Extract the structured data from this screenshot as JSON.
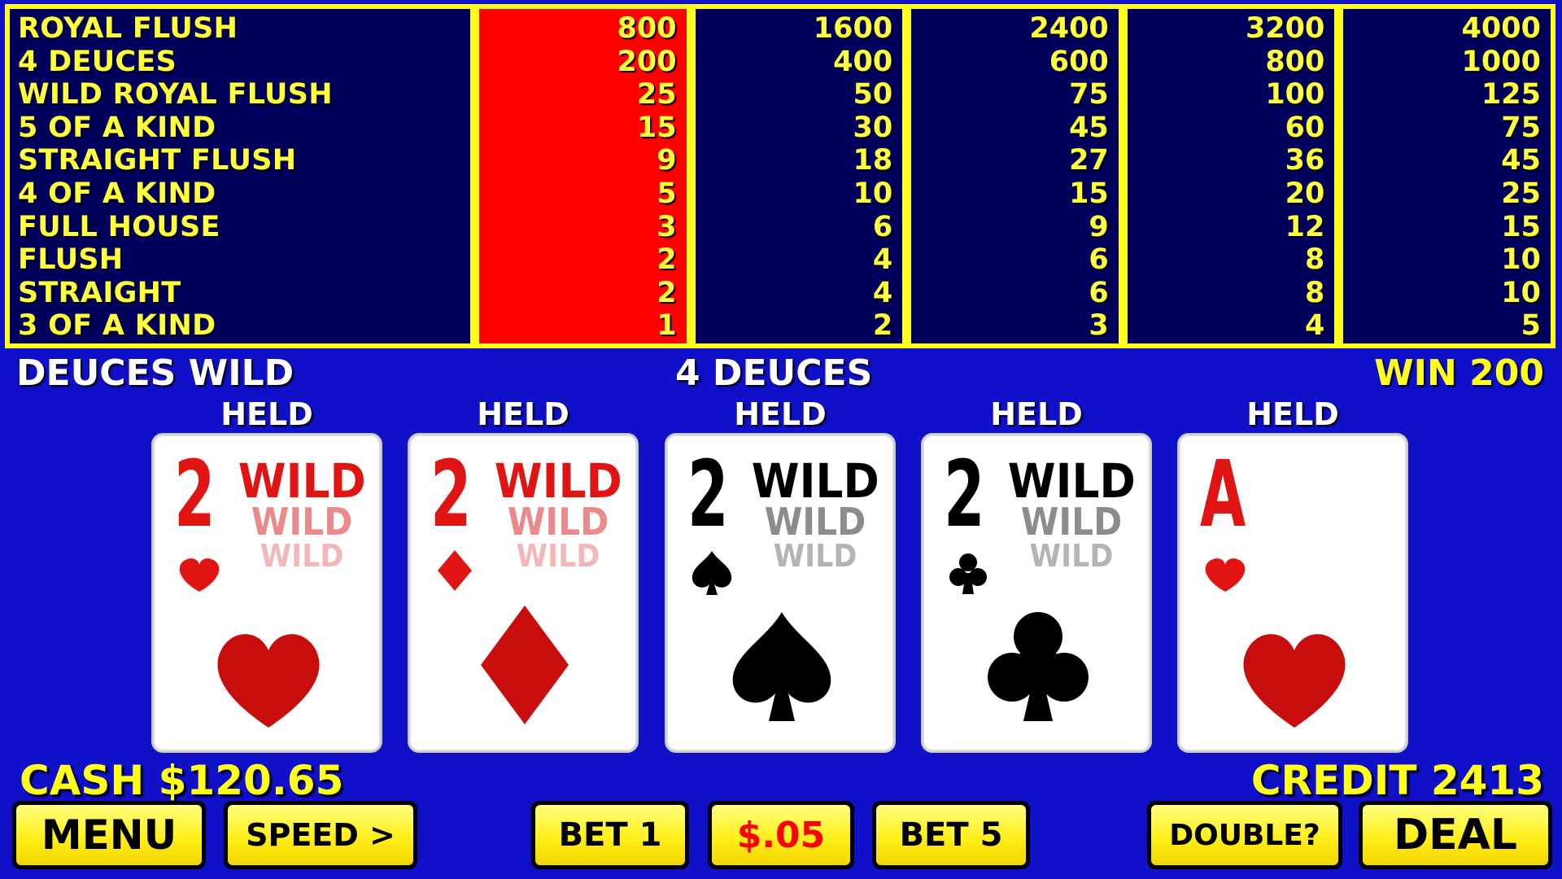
{
  "paytable": {
    "hands": [
      "ROYAL FLUSH",
      "4 DEUCES",
      "WILD ROYAL FLUSH",
      "5 OF A KIND",
      "STRAIGHT FLUSH",
      "4 OF A KIND",
      "FULL HOUSE",
      "FLUSH",
      "STRAIGHT",
      "3 OF A KIND"
    ],
    "columns": [
      [
        "800",
        "200",
        "25",
        "15",
        "9",
        "5",
        "3",
        "2",
        "2",
        "1"
      ],
      [
        "1600",
        "400",
        "50",
        "30",
        "18",
        "10",
        "6",
        "4",
        "4",
        "2"
      ],
      [
        "2400",
        "600",
        "75",
        "45",
        "27",
        "15",
        "9",
        "6",
        "6",
        "3"
      ],
      [
        "3200",
        "800",
        "100",
        "60",
        "36",
        "20",
        "12",
        "8",
        "8",
        "4"
      ],
      [
        "4000",
        "1000",
        "125",
        "75",
        "45",
        "25",
        "15",
        "10",
        "10",
        "5"
      ]
    ],
    "active_column": 1
  },
  "status": {
    "game_name": "DEUCES WILD",
    "hand_result": "4 DEUCES",
    "win": "WIN 200"
  },
  "cards": [
    {
      "held_label": "HELD",
      "rank": "2",
      "suit": "hearts",
      "wild": [
        "WILD",
        "WILD",
        "WILD"
      ]
    },
    {
      "held_label": "HELD",
      "rank": "2",
      "suit": "diamonds",
      "wild": [
        "WILD",
        "WILD",
        "WILD"
      ]
    },
    {
      "held_label": "HELD",
      "rank": "2",
      "suit": "spades",
      "wild": [
        "WILD",
        "WILD",
        "WILD"
      ]
    },
    {
      "held_label": "HELD",
      "rank": "2",
      "suit": "clubs",
      "wild": [
        "WILD",
        "WILD",
        "WILD"
      ]
    },
    {
      "held_label": "HELD",
      "rank": "A",
      "suit": "hearts",
      "wild": []
    }
  ],
  "footer": {
    "cash": "CASH $120.65",
    "credit": "CREDIT 2413"
  },
  "buttons": {
    "menu": "MENU",
    "speed": "SPEED >",
    "bet1": "BET 1",
    "denom": "$.05",
    "bet5": "BET 5",
    "double": "DOUBLE?",
    "deal": "DEAL"
  },
  "colors": {
    "background": "#0f10c8",
    "paytable_frame": "#ffff1a",
    "paytable_bg": "#00005c",
    "active_column": "#ff0000",
    "card_red": "#e11414",
    "button_yellow": "#ffef1a"
  }
}
